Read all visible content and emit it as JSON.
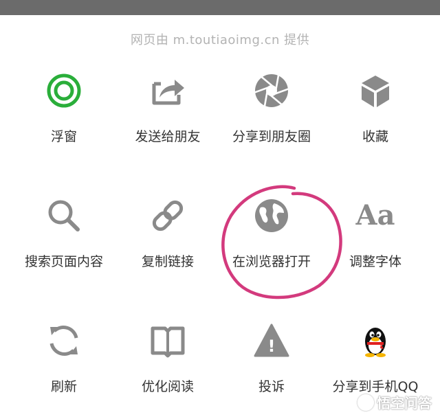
{
  "source_text": "网页由 m.toutiaoimg.cn 提供",
  "actions": [
    {
      "label": "浮窗",
      "icon": "floating-window-icon"
    },
    {
      "label": "发送给朋友",
      "icon": "share-arrow-icon"
    },
    {
      "label": "分享到朋友圈",
      "icon": "moments-shutter-icon"
    },
    {
      "label": "收藏",
      "icon": "favorite-cube-icon"
    },
    {
      "label": "搜索页面内容",
      "icon": "search-icon"
    },
    {
      "label": "复制链接",
      "icon": "link-icon"
    },
    {
      "label": "在浏览器打开",
      "icon": "globe-icon"
    },
    {
      "label": "调整字体",
      "icon": "font-size-icon",
      "glyph": "Aa"
    },
    {
      "label": "刷新",
      "icon": "refresh-icon"
    },
    {
      "label": "优化阅读",
      "icon": "book-icon"
    },
    {
      "label": "投诉",
      "icon": "warning-icon",
      "glyph": "!"
    },
    {
      "label": "分享到手机QQ",
      "icon": "qq-penguin-icon"
    }
  ],
  "colors": {
    "icon_gray": "#8a8a8a",
    "floating_green": "#2aae3a",
    "annotation_pink": "#d33a7d",
    "label_text": "#333333",
    "source_text": "#b3b3b3"
  },
  "watermark": "悟空问答"
}
